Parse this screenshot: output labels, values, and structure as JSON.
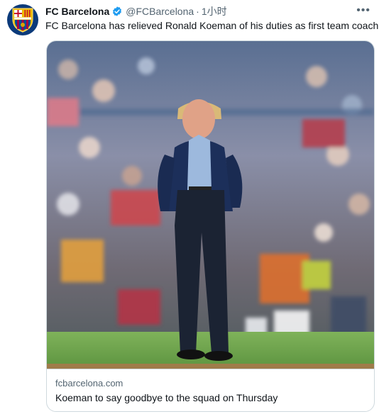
{
  "tweet": {
    "author_name": "FC Barcelona",
    "handle": "@FCBarcelona",
    "separator": "·",
    "time": "1小时",
    "more_label": "•••",
    "text": "FC Barcelona has relieved Ronald Koeman of his duties as first team coach",
    "verified_icon": "verified-badge-icon",
    "avatar_icon": "fc-barcelona-crest",
    "avatar_crest_letters": "FCB"
  },
  "card": {
    "domain": "fcbarcelona.com",
    "title": "Koeman to say goodbye to the squad on Thursday",
    "image": "photo of coach standing on pitch in front of stadium crowd"
  },
  "colors": {
    "text_primary": "#0f1419",
    "text_secondary": "#536471",
    "verified_blue": "#1d9bf0",
    "card_border": "#cfd9de",
    "barca_blue": "#004d98",
    "barca_garnet": "#a50044"
  }
}
